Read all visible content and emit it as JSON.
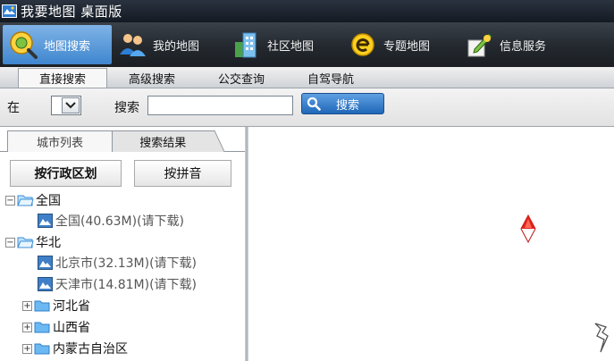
{
  "window": {
    "title": "我要地图 桌面版"
  },
  "toolbar": {
    "items": [
      {
        "label": "地图搜索",
        "icon": "globe-search-icon",
        "active": true
      },
      {
        "label": "我的地图",
        "icon": "users-icon",
        "active": false
      },
      {
        "label": "社区地图",
        "icon": "buildings-icon",
        "active": false
      },
      {
        "label": "专题地图",
        "icon": "topic-e-icon",
        "active": false
      },
      {
        "label": "信息服务",
        "icon": "pen-paper-icon",
        "active": false
      }
    ]
  },
  "subtabs": [
    "直接搜索",
    "高级搜索",
    "公交查询",
    "自驾导航"
  ],
  "search": {
    "in_label": "在",
    "search_label": "搜索",
    "value": "",
    "button_label": "搜索"
  },
  "panel": {
    "tabs": [
      "城市列表",
      "搜索结果"
    ],
    "buttons": [
      "按行政区划",
      "按拼音"
    ],
    "tree": {
      "national": {
        "label": "全国",
        "child": "全国(40.63M)(请下载)"
      },
      "huabei": {
        "label": "华北",
        "children": [
          "北京市(32.13M)(请下载)",
          "天津市(14.81M)(请下载)"
        ],
        "provinces": [
          "河北省",
          "山西省",
          "内蒙古自治区"
        ]
      }
    }
  },
  "colors": {
    "accent": "#3f86cf",
    "toolbar_bg": "#23282e",
    "compass_red": "#e02418"
  }
}
